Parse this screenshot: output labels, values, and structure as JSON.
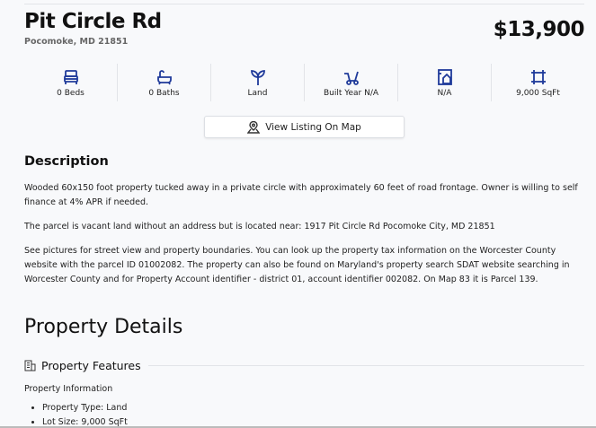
{
  "listing": {
    "title": "Pit Circle Rd",
    "address": "Pocomoke, MD 21851",
    "price": "$13,900"
  },
  "stats": [
    {
      "icon": "bed-icon",
      "label": "0 Beds"
    },
    {
      "icon": "bath-icon",
      "label": "0 Baths"
    },
    {
      "icon": "plant-icon",
      "label": "Land"
    },
    {
      "icon": "wheelbarrow-icon",
      "label": "Built Year N/A"
    },
    {
      "icon": "house-blueprint-icon",
      "label": "N/A"
    },
    {
      "icon": "area-icon",
      "label": "9,000 SqFt"
    }
  ],
  "map_button": "View Listing On Map",
  "description": {
    "heading": "Description",
    "paragraphs": [
      "Wooded 60x150 foot property tucked away in a private circle with approximately 60 feet of road frontage. Owner is willing to self finance at 4% APR if needed.",
      "The parcel is vacant land without an address but is located near: 1917 Pit Circle Rd Pocomoke City, MD 21851",
      "See pictures for street view and property boundaries. You can look up the property tax information on the Worcester County website with the parcel ID 01002082. The property can also be found on Maryland's property search SDAT website searching in Worcester County and for Property Account identifier - district 01, account identifier 002082. On Map 83 it is Parcel 139."
    ]
  },
  "details": {
    "heading": "Property Details",
    "features_heading": "Property Features",
    "info_heading": "Property Information",
    "items": [
      "Property Type: Land",
      "Lot Size: 9,000 SqFt"
    ]
  },
  "colors": {
    "icon": "#1f3a9a",
    "background": "#f8f9fb"
  }
}
